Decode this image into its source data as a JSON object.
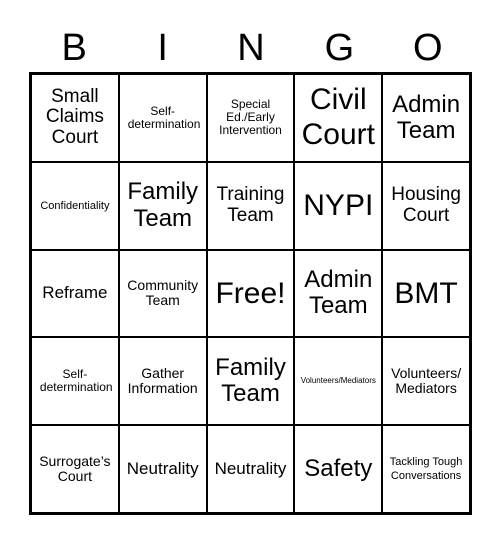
{
  "header": {
    "letters": [
      "B",
      "I",
      "N",
      "G",
      "O"
    ]
  },
  "cells": [
    "Small Claims Court",
    "Self-determination",
    "Special Ed./Early Intervention",
    "Civil Court",
    "Admin Team",
    "Confidentiality",
    "Family Team",
    "Training Team",
    "NYPI",
    "Housing Court",
    "Reframe",
    "Community Team",
    "Free!",
    "Admin Team",
    "BMT",
    "Self-determination",
    "Gather Information",
    "Family Team",
    "Volunteers/Mediators",
    "Volunteers/ Mediators",
    "Surrogate’s Court",
    "Neutrality",
    "Neutrality",
    "Safety",
    "Tackling Tough Conversations"
  ]
}
